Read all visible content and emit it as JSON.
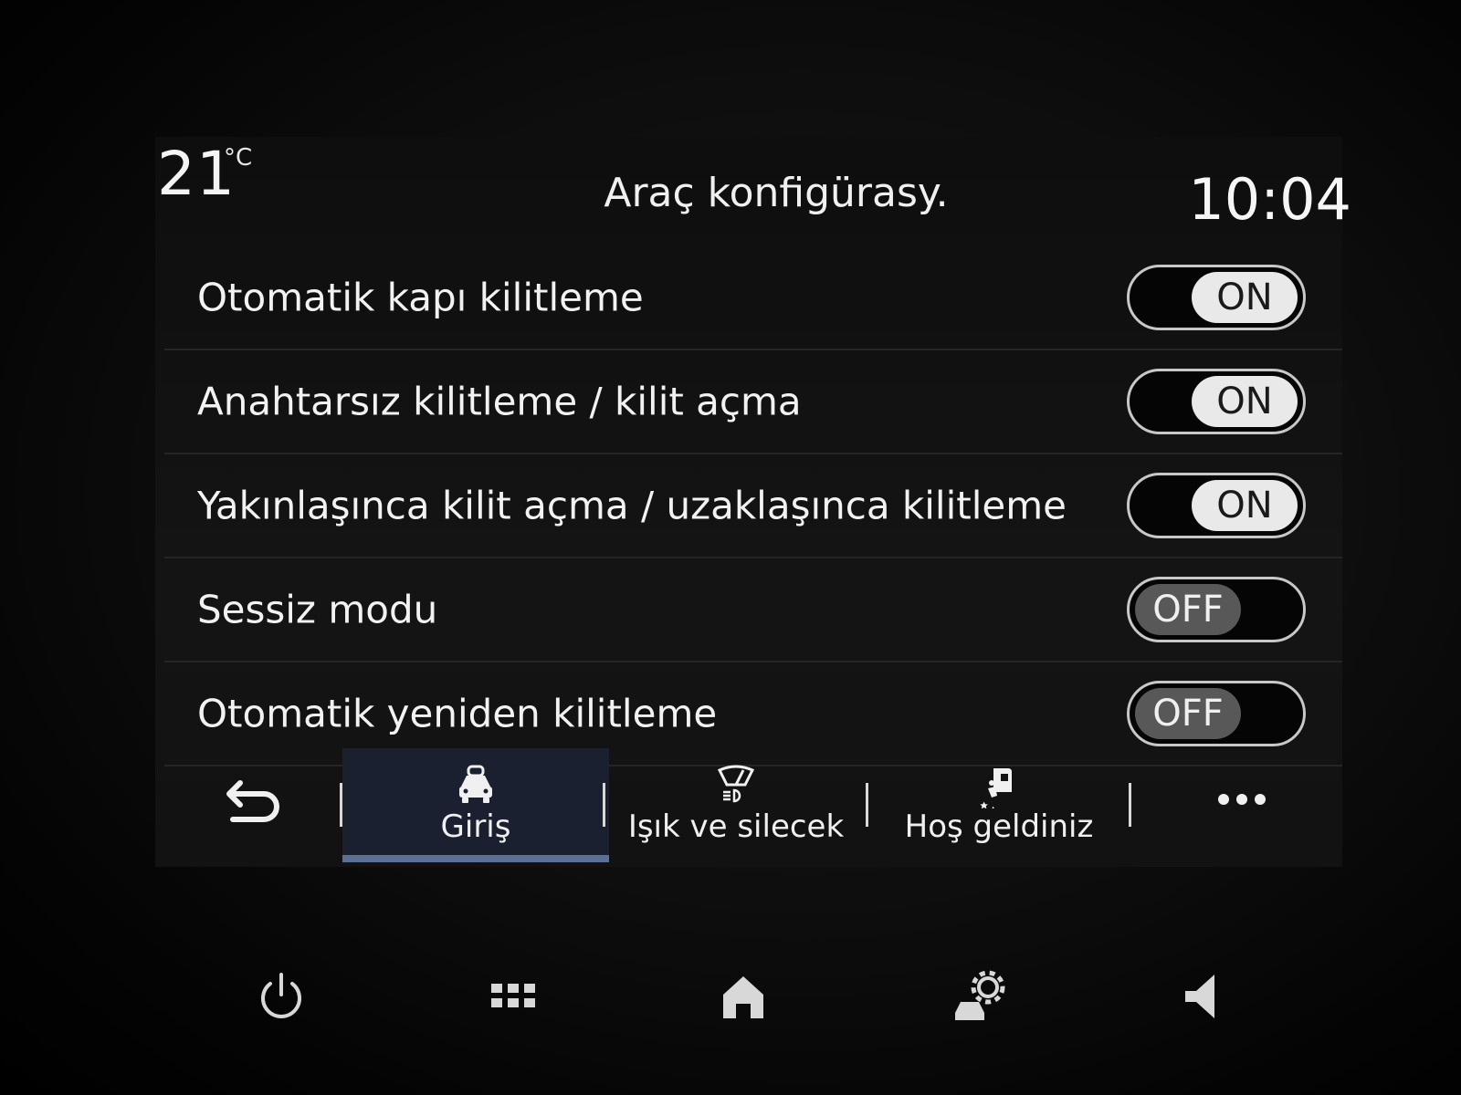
{
  "header": {
    "temperature": "21",
    "temperature_unit": "°C",
    "title": "Araç konfigürasy.",
    "time": "10:04"
  },
  "settings": [
    {
      "label": "Otomatik kapı kilitleme",
      "state": "ON"
    },
    {
      "label": "Anahtarsız kilitleme / kilit açma",
      "state": "ON"
    },
    {
      "label": "Yakınlaşınca kilit açma / uzaklaşınca kilitleme",
      "state": "ON"
    },
    {
      "label": "Sessiz modu",
      "state": "OFF"
    },
    {
      "label": "Otomatik yeniden kilitleme",
      "state": "OFF"
    }
  ],
  "tabs": [
    {
      "label": "Giriş",
      "icon": "car-lock-icon",
      "active": true
    },
    {
      "label": "Işık ve silecek",
      "icon": "light-wiper-icon",
      "active": false
    },
    {
      "label": "Hoş geldiniz",
      "icon": "welcome-icon",
      "active": false
    }
  ],
  "tabbar_icons": {
    "back": "back-arrow-icon",
    "more": "more-dots-icon"
  },
  "system_bar": [
    "power-icon",
    "apps-grid-icon",
    "home-icon",
    "vehicle-settings-icon",
    "volume-icon"
  ],
  "colors": {
    "active_tab_bg": "#1b2030",
    "active_tab_indicator": "#5c6f94",
    "toggle_on_knob": "#e9e9e9",
    "toggle_off_knob": "#585858"
  }
}
